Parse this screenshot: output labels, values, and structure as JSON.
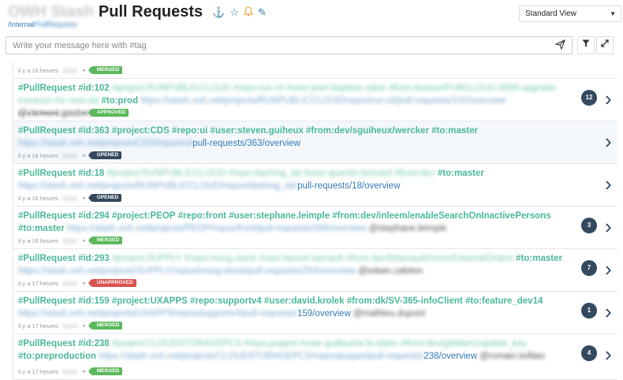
{
  "header": {
    "title_prefix": "OWH Stash",
    "title": "Pull Requests",
    "icons": [
      "anchor-icon",
      "star-icon",
      "bell-icon",
      "pencil-icon"
    ],
    "breadcrumb": [
      "/Internal/",
      "PullRequests"
    ]
  },
  "view_select": {
    "value": "Standard View"
  },
  "message": {
    "placeholder": "Write your message here with #tag"
  },
  "items": [
    {
      "meta_time": "il y a 16 heures",
      "meta_author": "Stash",
      "badge": "MERGED",
      "tags": [],
      "url": "",
      "url_tail": "",
      "mention": "",
      "count": "",
      "chevron": false
    },
    {
      "tags": [
        "#PullRequest",
        "#id:102",
        "#project:RUNPUBLICCLOUD",
        "#repo:run-cli",
        "#user:jean-baptiste.rabin",
        "#from:feature/PUBCLOUD-3056-upgrade-travauxs-for-new-tat",
        "#to:prod"
      ],
      "url": "https://stash.ovh.net/projects/RUNPUBLICCLOUD/repos/run-cli/pull-requests/102/overview",
      "url_tail": "",
      "mention": "@clement.goubert",
      "meta_time": "il y a 16 heures",
      "meta_author": "Stash",
      "badge": "APPROVED",
      "count": "12",
      "chevron": true
    },
    {
      "tags": [
        "#PullRequest",
        "#id:363",
        "#project:CDS",
        "#repo:ui",
        "#user:steven.guiheux",
        "#from:dev/sguiheux/wercker",
        "#to:master"
      ],
      "url": "https://stash.ovh.net/projects/CDS/repos/ui/",
      "url_tail": "pull-requests/363/overview",
      "mention": "",
      "meta_time": "il y a 16 heures",
      "meta_author": "Stash",
      "badge": "OPENED",
      "count": "",
      "chevron": true
    },
    {
      "tags": [
        "#PullRequest",
        "#id:18",
        "#project:RUNPUBLICCLOUD",
        "#repo:dashing_tat",
        "#user:quentin.bernard",
        "#from:dev",
        "#to:master"
      ],
      "url": "https://stash.ovh.net/projects/RUNPUBLICCLOUD/repos/dashing_tat/",
      "url_tail": "pull-requests/18/overview",
      "mention": "",
      "meta_time": "il y a 16 heures",
      "meta_author": "Stash",
      "badge": "OPENED",
      "count": "",
      "chevron": true
    },
    {
      "tags": [
        "#PullRequest",
        "#id:294",
        "#project:PEOP",
        "#repo:front",
        "#user:stephane.leimple",
        "#from:dev/inleem/enableSearchOnInactivePersons",
        "#to:master"
      ],
      "url": "https://stash.ovh.net/projects/PEOP/repos/front/pull-requests/294/overview",
      "url_tail": "",
      "mention": "@stephane.leimple",
      "meta_time": "il y a 16 heures",
      "meta_author": "Stash",
      "badge": "MERGED",
      "count": "3",
      "chevron": true
    },
    {
      "tags": [
        "#PullRequest",
        "#id:293",
        "#project:SUPPLY",
        "#repo:mozg-stock",
        "#user:benoit.hamault",
        "#from:dev/bhamault/mirrorExternalOrders",
        "#to:master"
      ],
      "url": "https://stash.ovh.net/projects/SUPPLY/repos/mozg-stock/pull-requests/293/overview",
      "url_tail": "",
      "mention": "@edwin.cabiten",
      "meta_time": "il y a 17 heures",
      "meta_author": "Stash",
      "badge": "UNAPPROVED",
      "count": "7",
      "chevron": true
    },
    {
      "tags": [
        "#PullRequest",
        "#id:159",
        "#project:UXAPPS",
        "#repo:supportv4",
        "#user:david.krolek",
        "#from:dk/SV-365-infoClient",
        "#to:feature_dev14"
      ],
      "url": "https://stash.ovh.net/projects/UXAPPS/repos/supportv4/pull-requests/",
      "url_tail": "159/overview",
      "mention": "@mathieu.dupont",
      "meta_time": "il y a 17 heures",
      "meta_author": "Stash",
      "badge": "MERGED",
      "count": "1",
      "chevron": true
    },
    {
      "tags": [
        "#PullRequest",
        "#id:238",
        "#project:CLOUDSTORAGEPCS",
        "#repo:puppet",
        "#user:guillaume.le-blanc",
        "#from:dev/gleblanc/update_key",
        "#to:preproduction"
      ],
      "url": "https://stash.ovh.net/projects/CLOUDSTORAGEPCS/repos/puppet/pull-requests/",
      "url_tail": "238/overview",
      "mention": "@romain.teillaio",
      "meta_time": "il y a 17 heures",
      "meta_author": "Stash",
      "badge": "MERGED",
      "count": "4",
      "chevron": true
    }
  ]
}
